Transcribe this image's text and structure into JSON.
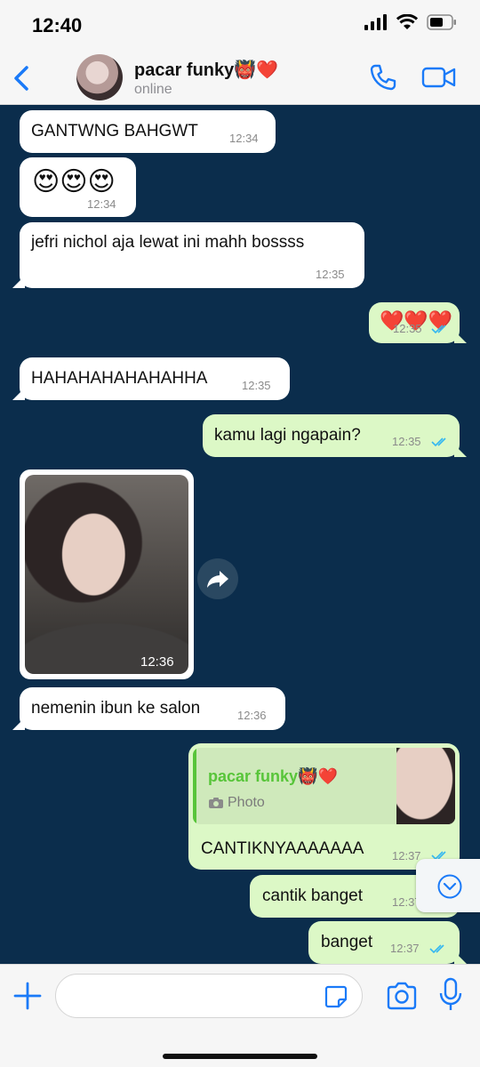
{
  "status_bar": {
    "time": "12:40"
  },
  "header": {
    "back_label": "",
    "contact_name": "pacar funky👹❤️",
    "contact_status": "online"
  },
  "messages": [
    {
      "text": "GANTWNG BAHGWT",
      "time": "12:34",
      "direction": "in"
    },
    {
      "text": "😍😍😍",
      "time": "12:34",
      "direction": "in"
    },
    {
      "text": "jefri nichol aja lewat ini mahh bossss",
      "time": "12:35",
      "direction": "in"
    },
    {
      "text": "❤️❤️❤️",
      "time": "12:35",
      "direction": "out",
      "read": true
    },
    {
      "text": "HAHAHAHAHAHAHHA",
      "time": "12:35",
      "direction": "in"
    },
    {
      "text": "kamu lagi ngapain?",
      "time": "12:35",
      "direction": "out",
      "read": true
    },
    {
      "type": "photo",
      "time": "12:36",
      "direction": "in"
    },
    {
      "text": "nemenin ibun ke salon",
      "time": "12:36",
      "direction": "in"
    },
    {
      "text": "CANTIKNYAAAAAAA",
      "time": "12:37",
      "direction": "out",
      "read": true,
      "reply": {
        "author": "pacar funky👹❤️",
        "kind": "Photo"
      }
    },
    {
      "text": "cantik banget",
      "time": "12:37",
      "direction": "out",
      "read": true
    },
    {
      "text": "banget",
      "time": "12:37",
      "direction": "out",
      "read": true
    }
  ],
  "colors": {
    "chat_background": "#0b2d4c",
    "incoming_bubble": "#ffffff",
    "outgoing_bubble": "#dcf8c6",
    "accent": "#1a7af8",
    "read_ticks": "#34b7f1",
    "reply_author": "#58c53a"
  },
  "icons": [
    "back-chevron-icon",
    "phone-icon",
    "video-camera-icon",
    "forward-icon",
    "scroll-down-icon",
    "plus-icon",
    "sticker-icon",
    "camera-icon",
    "microphone-icon"
  ]
}
